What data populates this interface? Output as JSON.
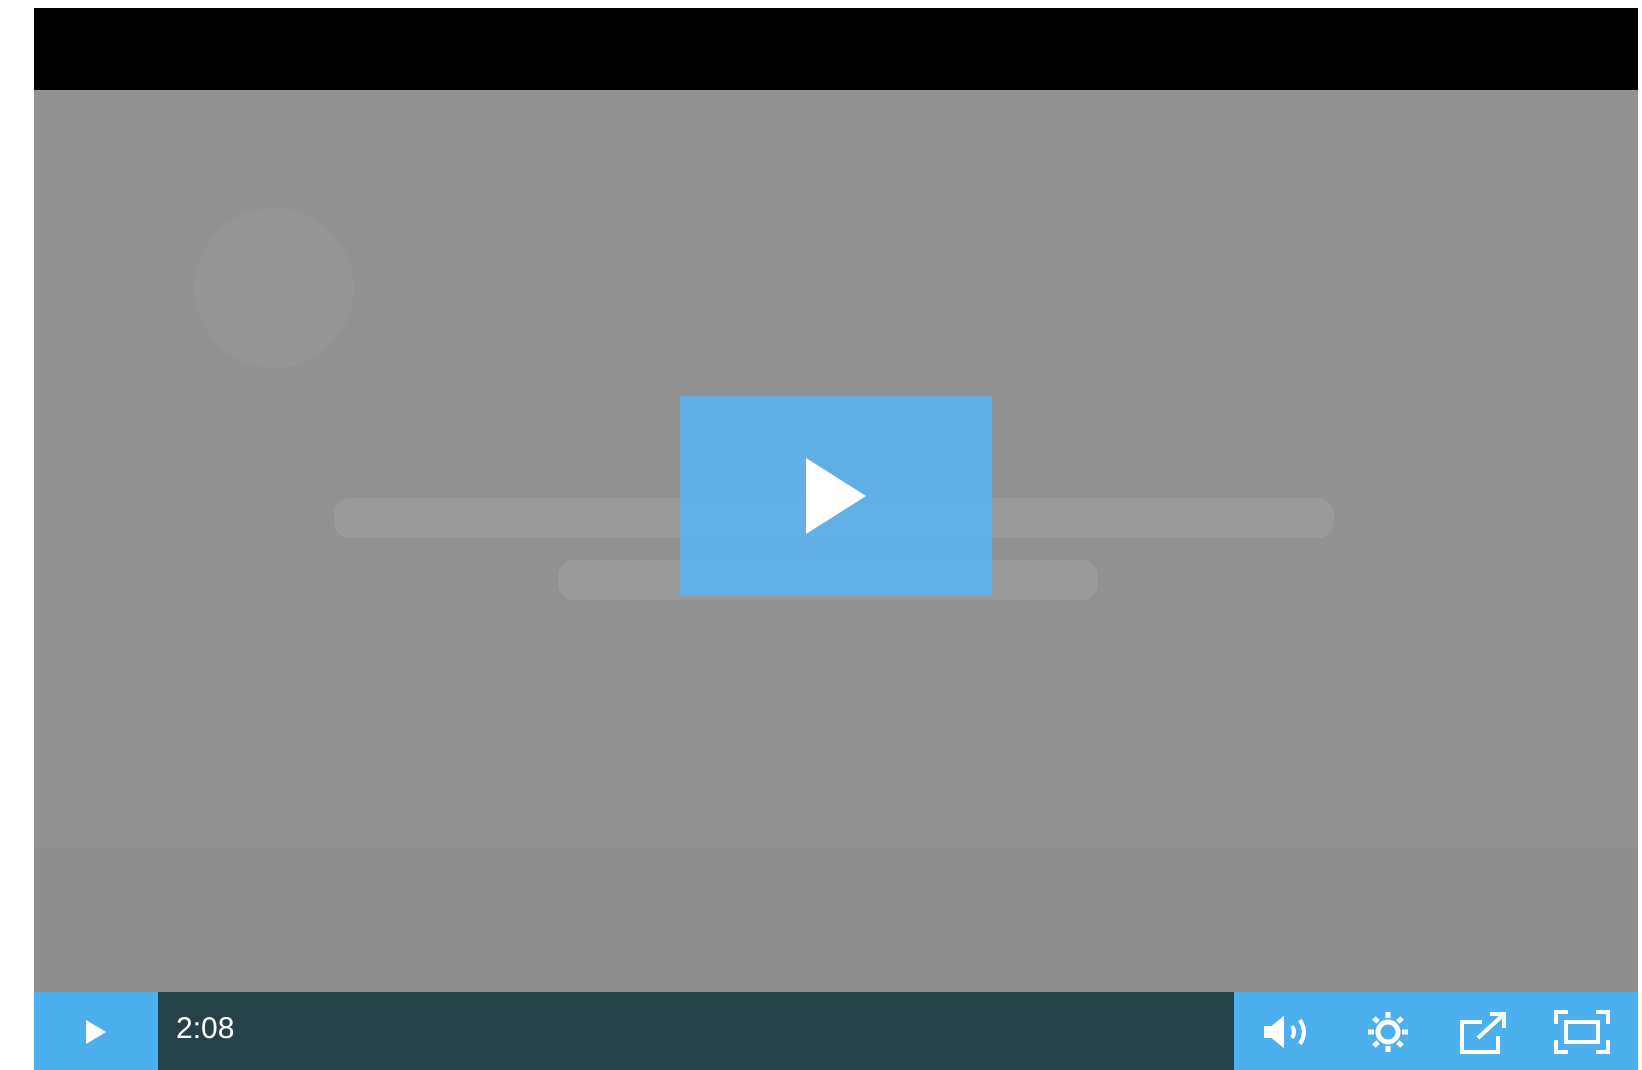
{
  "player": {
    "time": "2:08"
  }
}
